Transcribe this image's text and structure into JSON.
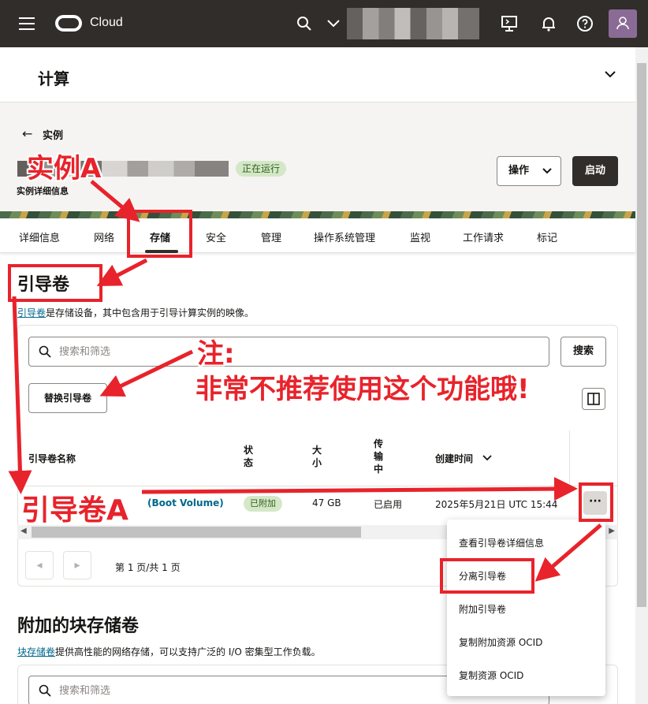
{
  "topbar": {
    "brand": "Cloud",
    "icons": [
      "menu-icon",
      "oracle-logo-icon",
      "search-icon",
      "chevron-down-icon",
      "cloud-shell-icon",
      "bell-icon",
      "help-icon",
      "user-icon"
    ]
  },
  "compute": {
    "title": "计算"
  },
  "instance": {
    "breadcrumb": "实例",
    "status": "正在运行",
    "subtitle": "实例详细信息",
    "actions_label": "操作",
    "start_label": "启动"
  },
  "tabs": [
    "详细信息",
    "网络",
    "存储",
    "安全",
    "管理",
    "操作系统管理",
    "监视",
    "工作请求",
    "标记"
  ],
  "boot": {
    "title": "引导卷",
    "desc_link": "引导卷",
    "desc_rest": "是存储设备，其中包含用于引导计算实例的映像。",
    "search_placeholder": "搜索和筛选",
    "search_button": "搜索",
    "replace_button": "替换引导卷",
    "columns": {
      "name": "引导卷名称",
      "status": "状态",
      "size": "大小",
      "transit": "传输中",
      "created": "创建时间"
    },
    "row": {
      "name": "(Boot Volume)",
      "status": "已附加",
      "size": "47 GB",
      "transit": "已启用",
      "created": "2025年5月21日 UTC 15:44"
    },
    "pagination": "第 1 页/共 1 页"
  },
  "menu": {
    "items": [
      "查看引导卷详细信息",
      "分离引导卷",
      "附加引导卷",
      "复制附加资源 OCID",
      "复制资源 OCID"
    ]
  },
  "block": {
    "title": "附加的块存储卷",
    "desc_link": "块存储卷",
    "desc_rest": "提供高性能的网络存储，可以支持广泛的 I/O 密集型工作负载。",
    "search_placeholder": "搜索和筛选"
  },
  "annotations": {
    "instance_a": "实例A",
    "note_title": "注:",
    "note_body": "非常不推荐使用这个功能哦!",
    "boot_volume_a": "引导卷A"
  },
  "colors": {
    "annotation": "#e8232b",
    "topbar": "#312d2a",
    "link": "#00688c",
    "badge_bg": "#d4e8c7"
  }
}
